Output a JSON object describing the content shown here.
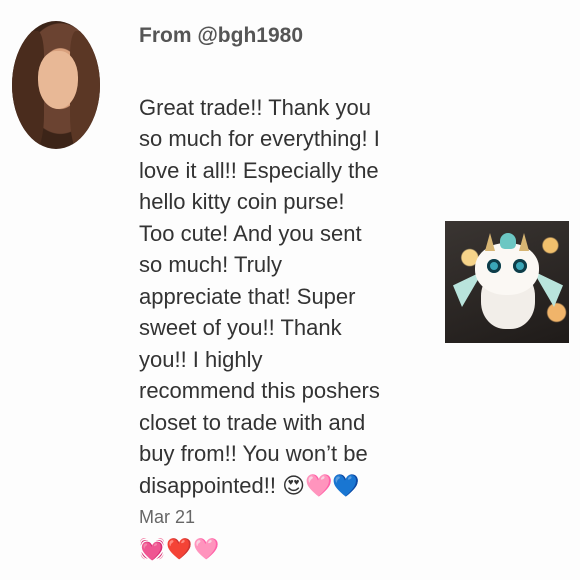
{
  "review": {
    "from": "From @bgh1980",
    "message": "Great trade!! Thank you\nso much for everything! I\nlove it all!! Especially the\nhello kitty coin purse!\nToo cute! And you sent\nso much! Truly\nappreciate that! Super\nsweet of you!! Thank\nyou!! I highly\nrecommend this poshers\ncloset to trade with and\nbuy from!! You won’t be\ndisappointed!! 😍🩷💙",
    "emojis": "💓❤️🩷",
    "date": "Mar 21"
  },
  "icons": {
    "avatar": "user-photo-avatar",
    "product": "dragon-figurine-thumbnail"
  }
}
